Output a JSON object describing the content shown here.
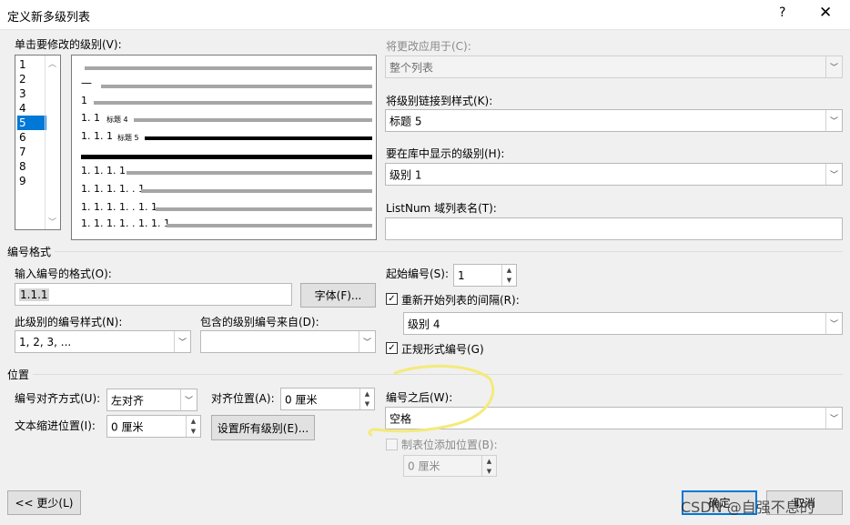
{
  "window": {
    "title": "定义新多级列表",
    "help": "?",
    "close": "✕"
  },
  "level_section": {
    "label": "单击要修改的级别(V):",
    "levels": [
      "1",
      "2",
      "3",
      "4",
      "5",
      "6",
      "7",
      "8",
      "9"
    ],
    "selected": "5"
  },
  "preview": {
    "dash": "—",
    "n1": "1",
    "n2": "1. 1",
    "n2_style": "标题 4",
    "n3": "1. 1. 1",
    "n3_style": "标题 5",
    "n5": "1. 1. 1. 1",
    "n6": "1. 1. 1. 1. . 1",
    "n7": "1. 1. 1. 1. . 1. 1",
    "n8": "1. 1. 1. 1. . 1. 1. 1"
  },
  "right_top": {
    "apply_to_label": "将更改应用于(C):",
    "apply_to_value": "整个列表",
    "link_style_label": "将级别链接到样式(K):",
    "link_style_value": "标题 5",
    "gallery_level_label": "要在库中显示的级别(H):",
    "gallery_level_value": "级别 1",
    "listnum_label": "ListNum 域列表名(T):",
    "listnum_value": ""
  },
  "number_format": {
    "section_label": "编号格式",
    "enter_format_label": "输入编号的格式(O):",
    "format_value": "1.1.1",
    "font_button": "字体(F)...",
    "style_label": "此级别的编号样式(N):",
    "style_value": "1, 2, 3, ...",
    "include_label": "包含的级别编号来自(D):",
    "include_value": "",
    "start_at_label": "起始编号(S):",
    "start_at_value": "1",
    "restart_label": "重新开始列表的间隔(R):",
    "restart_checked": true,
    "restart_value": "级别 4",
    "legal_label": "正规形式编号(G)",
    "legal_checked": true
  },
  "position": {
    "section_label": "位置",
    "alignment_label": "编号对齐方式(U):",
    "alignment_value": "左对齐",
    "aligned_at_label": "对齐位置(A):",
    "aligned_at_value": "0 厘米",
    "indent_label": "文本缩进位置(I):",
    "indent_value": "0 厘米",
    "set_all_button": "设置所有级别(E)...",
    "follow_label": "编号之后(W):",
    "follow_value": "空格",
    "tab_stop_label": "制表位添加位置(B):",
    "tab_stop_value": "0 厘米"
  },
  "footer": {
    "less_button": "<< 更少(L)",
    "ok_button": "确定",
    "cancel_button": "取消",
    "watermark": "CSDN @自强不息的"
  },
  "colors": {
    "selection": "#0078d7",
    "highlight_scribble": "#f4ea7a"
  }
}
